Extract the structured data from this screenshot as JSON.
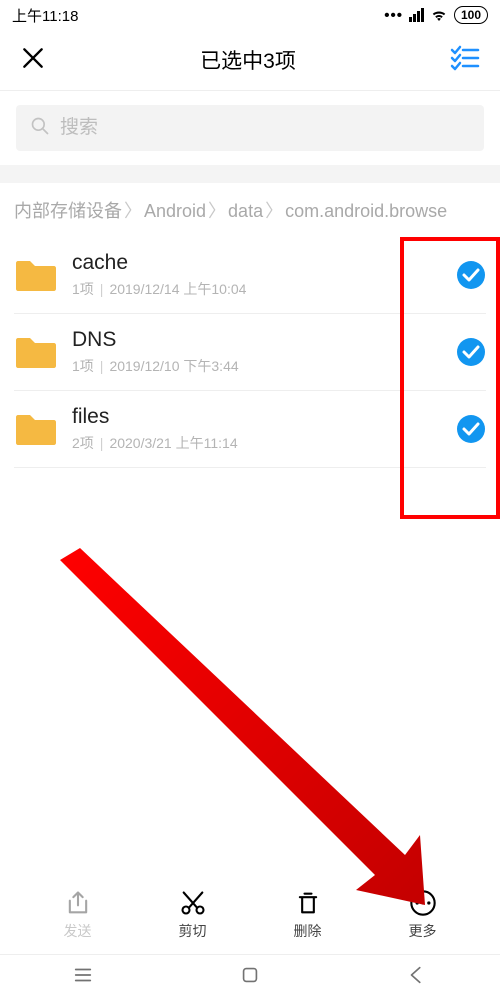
{
  "status": {
    "time": "上午11:18",
    "battery": "100"
  },
  "header": {
    "title": "已选中3项"
  },
  "search": {
    "placeholder": "搜索"
  },
  "breadcrumbs": [
    "内部存储设备",
    "Android",
    "data",
    "com.android.browse"
  ],
  "files": [
    {
      "name": "cache",
      "count": "1项",
      "time": "2019/12/14 上午10:04"
    },
    {
      "name": "DNS",
      "count": "1项",
      "time": "2019/12/10 下午3:44"
    },
    {
      "name": "files",
      "count": "2项",
      "time": "2020/3/21 上午11:14"
    }
  ],
  "actions": {
    "send": "发送",
    "cut": "剪切",
    "delete": "删除",
    "more": "更多"
  }
}
